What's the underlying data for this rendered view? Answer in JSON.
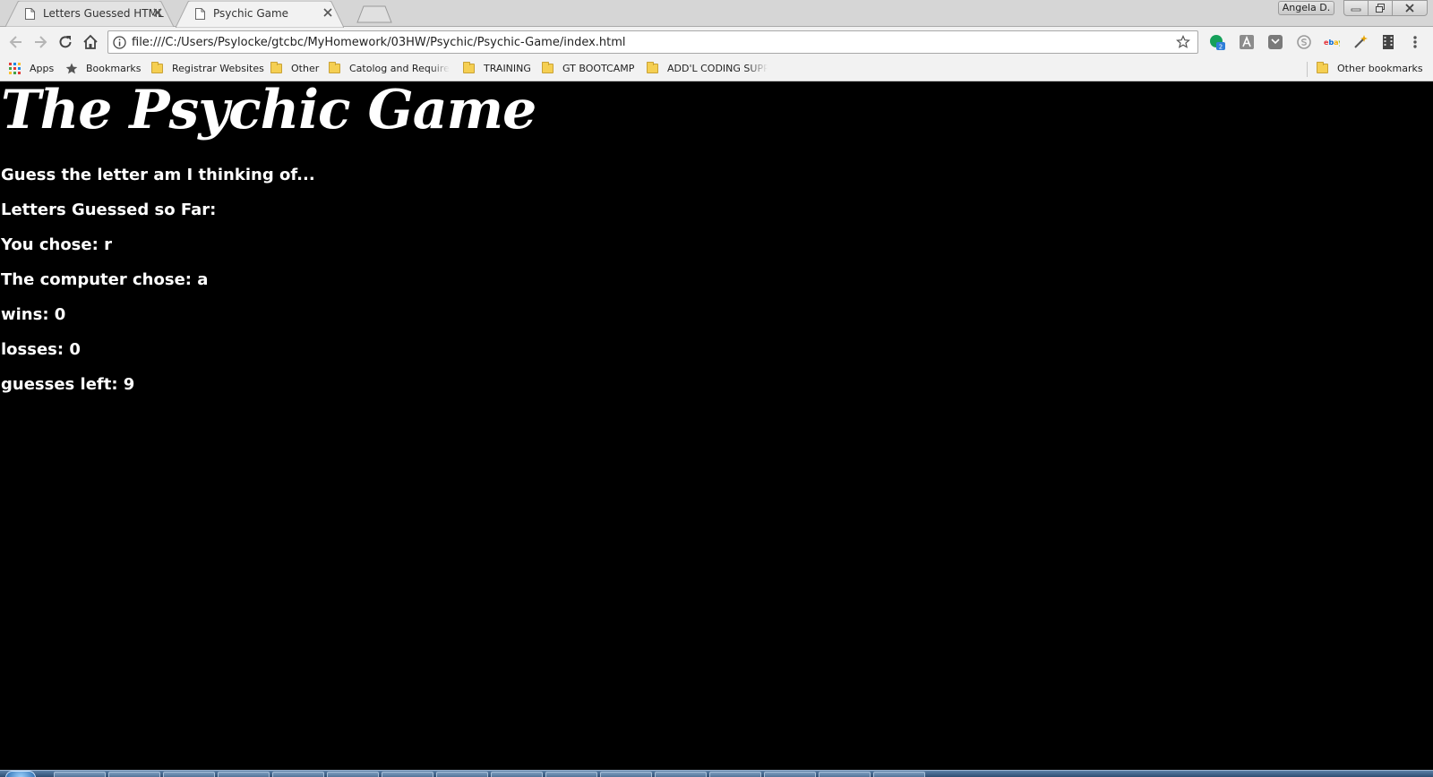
{
  "browser": {
    "tabs": [
      {
        "title": "Letters Guessed HTML",
        "active": false
      },
      {
        "title": "Psychic Game",
        "active": true
      }
    ],
    "profile_name": "Angela D.",
    "address_bar": {
      "url": "file:///C:/Users/Psylocke/gtcbc/MyHomework/03HW/Psychic/Psychic-Game/index.html"
    },
    "extension_badge": "2",
    "bookmarks": [
      {
        "label": "Apps",
        "icon": "apps-grid-icon"
      },
      {
        "label": "Bookmarks",
        "icon": "star-icon"
      },
      {
        "label": "Registrar Websites",
        "icon": "folder-icon"
      },
      {
        "label": "Other",
        "icon": "folder-icon"
      },
      {
        "label": "Catolog and Requirer",
        "icon": "folder-icon"
      },
      {
        "label": "TRAINING",
        "icon": "folder-icon"
      },
      {
        "label": "GT BOOTCAMP",
        "icon": "folder-icon"
      },
      {
        "label": "ADD'L CODING SUPP",
        "icon": "folder-icon"
      },
      {
        "label": "Other bookmarks",
        "icon": "folder-icon"
      }
    ]
  },
  "page": {
    "title": "The Psychic Game",
    "prompt": "Guess the letter am I thinking of...",
    "letters_guessed": "Letters Guessed so Far:",
    "you_chose": "You chose: r",
    "computer_chose": "The computer chose: a",
    "wins": "wins: 0",
    "losses": "losses: 0",
    "guesses_left": "guesses left: 9"
  },
  "colors": {
    "page_background": "#000000",
    "page_text": "#ffffff",
    "chrome_background": "#f2f2f2",
    "folder": "#f5cf52"
  }
}
